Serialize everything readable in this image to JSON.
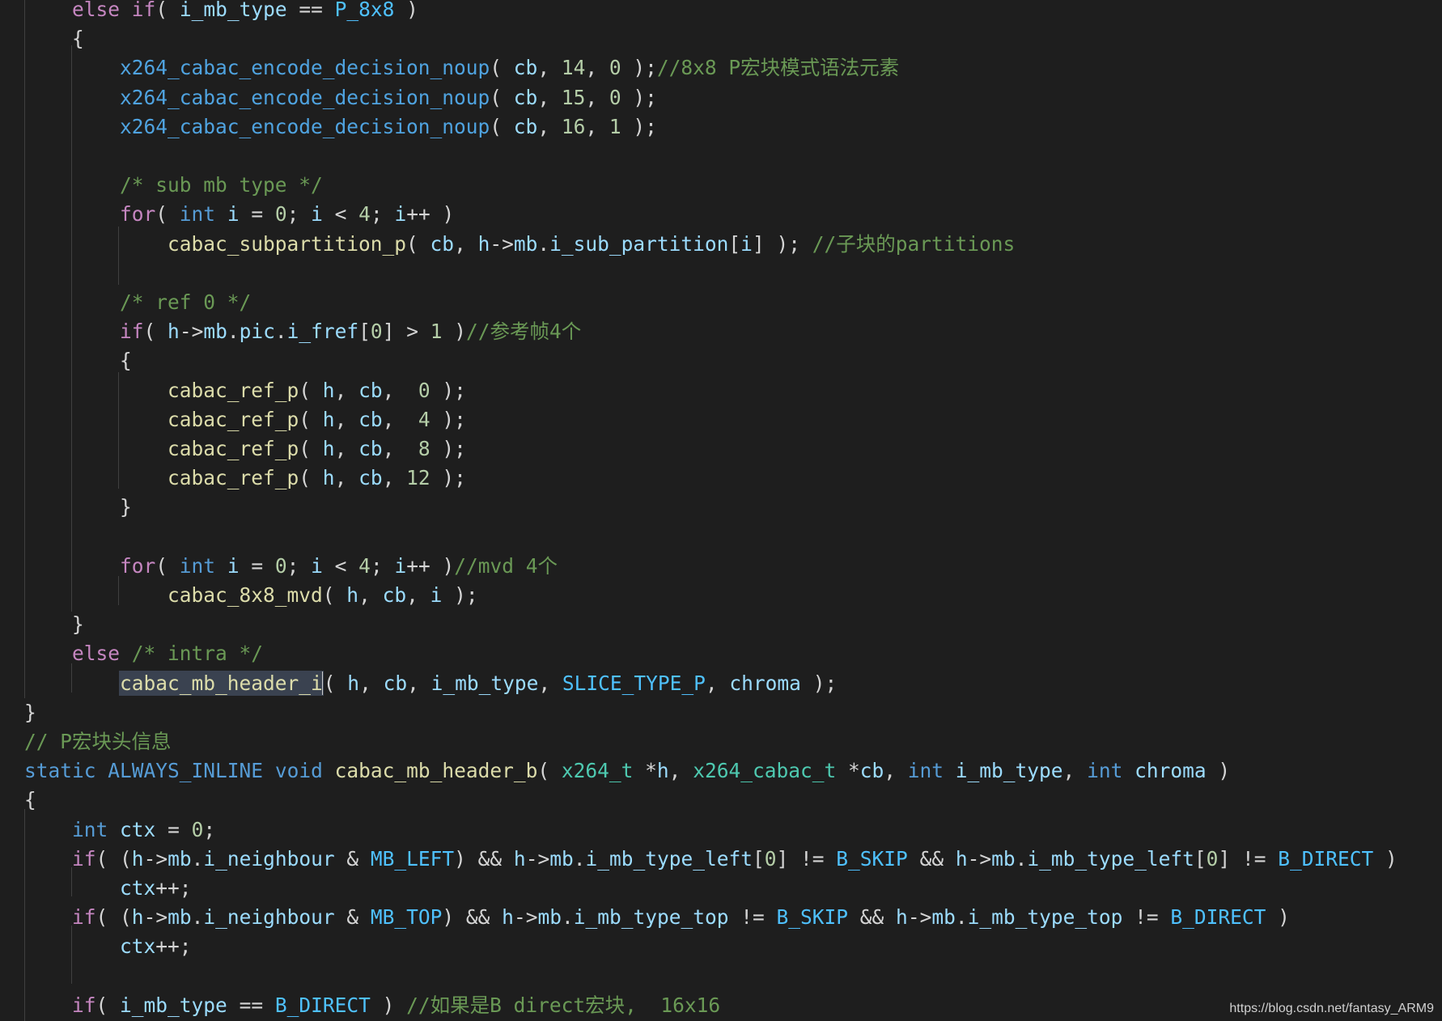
{
  "watermark": "https://blog.csdn.net/fantasy_ARM9",
  "code": {
    "lines": [
      [
        "    ",
        "else",
        " ",
        "if",
        "( ",
        "i_mb_type",
        " == ",
        "P_8x8",
        " )"
      ],
      [
        "    {"
      ],
      [
        "        ",
        "x264_cabac_encode_decision_noup",
        "( ",
        "cb",
        ", ",
        "14",
        ", ",
        "0",
        " );",
        "//8x8 P宏块模式语法元素"
      ],
      [
        "        ",
        "x264_cabac_encode_decision_noup",
        "( ",
        "cb",
        ", ",
        "15",
        ", ",
        "0",
        " );"
      ],
      [
        "        ",
        "x264_cabac_encode_decision_noup",
        "( ",
        "cb",
        ", ",
        "16",
        ", ",
        "1",
        " );"
      ],
      [
        ""
      ],
      [
        "        ",
        "/* sub mb type */"
      ],
      [
        "        ",
        "for",
        "( ",
        "int",
        " ",
        "i",
        " = ",
        "0",
        "; ",
        "i",
        " < ",
        "4",
        "; ",
        "i",
        "++ )"
      ],
      [
        "            ",
        "cabac_subpartition_p",
        "( ",
        "cb",
        ", ",
        "h",
        "->",
        "mb",
        ".",
        "i_sub_partition",
        "[",
        "i",
        "] ); ",
        "//子块的partitions"
      ],
      [
        ""
      ],
      [
        "        ",
        "/* ref 0 */"
      ],
      [
        "        ",
        "if",
        "( ",
        "h",
        "->",
        "mb",
        ".",
        "pic",
        ".",
        "i_fref",
        "[",
        "0",
        "] > ",
        "1",
        " )",
        "//参考帧4个"
      ],
      [
        "        {"
      ],
      [
        "            ",
        "cabac_ref_p",
        "( ",
        "h",
        ", ",
        "cb",
        ",  ",
        "0",
        " );"
      ],
      [
        "            ",
        "cabac_ref_p",
        "( ",
        "h",
        ", ",
        "cb",
        ",  ",
        "4",
        " );"
      ],
      [
        "            ",
        "cabac_ref_p",
        "( ",
        "h",
        ", ",
        "cb",
        ",  ",
        "8",
        " );"
      ],
      [
        "            ",
        "cabac_ref_p",
        "( ",
        "h",
        ", ",
        "cb",
        ", ",
        "12",
        " );"
      ],
      [
        "        }"
      ],
      [
        ""
      ],
      [
        "        ",
        "for",
        "( ",
        "int",
        " ",
        "i",
        " = ",
        "0",
        "; ",
        "i",
        " < ",
        "4",
        "; ",
        "i",
        "++ )",
        "//mvd 4个"
      ],
      [
        "            ",
        "cabac_8x8_mvd",
        "( ",
        "h",
        ", ",
        "cb",
        ", ",
        "i",
        " );"
      ],
      [
        "    }"
      ],
      [
        "    ",
        "else",
        " ",
        "/* intra */"
      ],
      [
        "        ",
        "cabac_mb_header_i",
        "( ",
        "h",
        ", ",
        "cb",
        ", ",
        "i_mb_type",
        ", ",
        "SLICE_TYPE_P",
        ", ",
        "chroma",
        " );"
      ],
      [
        "}"
      ],
      [
        "// P宏块头信息"
      ],
      [
        "static",
        " ",
        "ALWAYS_INLINE",
        " ",
        "void",
        " ",
        "cabac_mb_header_b",
        "( ",
        "x264_t",
        " *",
        "h",
        ", ",
        "x264_cabac_t",
        " *",
        "cb",
        ", ",
        "int",
        " ",
        "i_mb_type",
        ", ",
        "int",
        " ",
        "chroma",
        " )"
      ],
      [
        "{"
      ],
      [
        "    ",
        "int",
        " ",
        "ctx",
        " = ",
        "0",
        ";"
      ],
      [
        "    ",
        "if",
        "( (",
        "h",
        "->",
        "mb",
        ".",
        "i_neighbour",
        " & ",
        "MB_LEFT",
        ") && ",
        "h",
        "->",
        "mb",
        ".",
        "i_mb_type_left",
        "[",
        "0",
        "] != ",
        "B_SKIP",
        " && ",
        "h",
        "->",
        "mb",
        ".",
        "i_mb_type_left",
        "[",
        "0",
        "] != ",
        "B_DIRECT",
        " )"
      ],
      [
        "        ",
        "ctx",
        "++;"
      ],
      [
        "    ",
        "if",
        "( (",
        "h",
        "->",
        "mb",
        ".",
        "i_neighbour",
        " & ",
        "MB_TOP",
        ") && ",
        "h",
        "->",
        "mb",
        ".",
        "i_mb_type_top",
        " != ",
        "B_SKIP",
        " && ",
        "h",
        "->",
        "mb",
        ".",
        "i_mb_type_top",
        " != ",
        "B_DIRECT",
        " )"
      ],
      [
        "        ",
        "ctx",
        "++;"
      ],
      [
        ""
      ],
      [
        "    ",
        "if",
        "( ",
        "i_mb_type",
        " == ",
        "B_DIRECT",
        " ) ",
        "//如果是B direct宏块,  16x16"
      ]
    ]
  },
  "colors": {
    "background": "#1e1e1e",
    "keyword": "#c586c0",
    "type": "#569cd6",
    "function": "#dcdcaa",
    "variable": "#9cdcfe",
    "number": "#b5cea8",
    "comment": "#6a9955",
    "constant": "#4fc1ff",
    "type_name": "#4ec9b0"
  }
}
